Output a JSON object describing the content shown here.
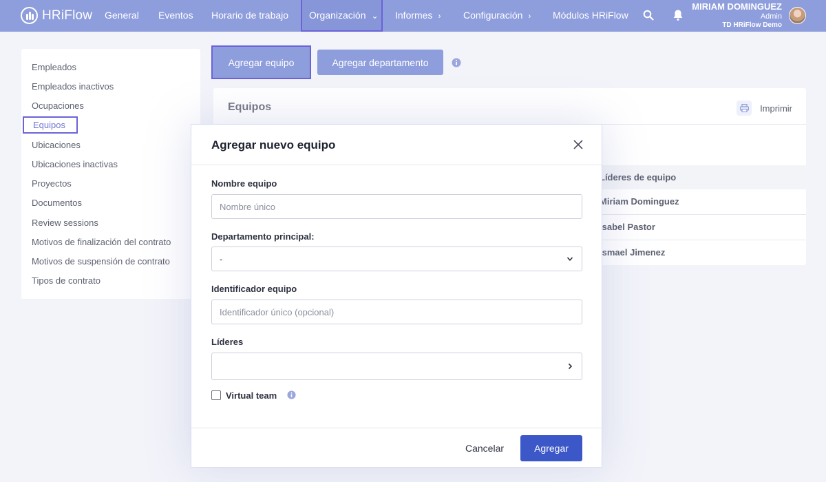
{
  "app": {
    "name": "HRiFlow"
  },
  "nav": {
    "items": [
      {
        "label": "General"
      },
      {
        "label": "Eventos"
      },
      {
        "label": "Horario de trabajo"
      },
      {
        "label": "Organización"
      },
      {
        "label": "Informes"
      },
      {
        "label": "Configuración"
      },
      {
        "label": "Módulos HRiFlow"
      }
    ],
    "active": "Organización"
  },
  "user": {
    "name": "MIRIAM DOMINGUEZ",
    "role": "Admin",
    "org": "TD HRiFlow Demo"
  },
  "sidebar": {
    "items": [
      {
        "label": "Empleados"
      },
      {
        "label": "Empleados inactivos"
      },
      {
        "label": "Ocupaciones"
      },
      {
        "label": "Equipos"
      },
      {
        "label": "Ubicaciones"
      },
      {
        "label": "Ubicaciones inactivas"
      },
      {
        "label": "Proyectos"
      },
      {
        "label": "Documentos"
      },
      {
        "label": "Review sessions"
      },
      {
        "label": "Motivos de finalización del contrato"
      },
      {
        "label": "Motivos de suspensión de contrato"
      },
      {
        "label": "Tipos de contrato"
      }
    ],
    "active": "Equipos"
  },
  "actions": {
    "add_team": "Agregar equipo",
    "add_department": "Agregar departamento"
  },
  "panel": {
    "title": "Equipos",
    "print": "Imprimir",
    "leaders_header": "Líderes de equipo",
    "rows": [
      "Miriam Dominguez",
      "Isabel Pastor",
      "Ismael Jimenez"
    ]
  },
  "modal": {
    "title": "Agregar nuevo equipo",
    "name_label": "Nombre equipo",
    "name_placeholder": "Nombre único",
    "dept_label": "Departamento principal:",
    "dept_value": "-",
    "id_label": "Identificador equipo",
    "id_placeholder": "Identificador único (opcional)",
    "leaders_label": "Líderes",
    "virtual_team": "Virtual team",
    "cancel": "Cancelar",
    "submit": "Agregar"
  },
  "colors": {
    "nav_bg": "#8e9ddc",
    "accent": "#3c57c8",
    "focus_outline": "#6b63d8"
  }
}
